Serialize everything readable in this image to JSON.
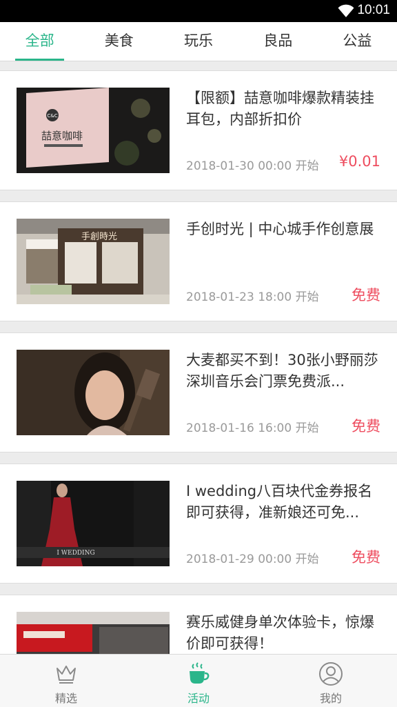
{
  "status_bar": {
    "time": "10:01"
  },
  "tabs": [
    {
      "label": "全部",
      "active": true
    },
    {
      "label": "美食",
      "active": false
    },
    {
      "label": "玩乐",
      "active": false
    },
    {
      "label": "良品",
      "active": false
    },
    {
      "label": "公益",
      "active": false
    }
  ],
  "events": [
    {
      "title": "【限额】喆意咖啡爆款精装挂耳包，内部折扣价",
      "date": "2018-01-30 00:00 开始",
      "price": "¥0.01",
      "thumb_sign_text": "喆意咖啡",
      "thumb_logo_text": "C&C"
    },
    {
      "title": "手创时光 | 中心城手作创意展",
      "date": "2018-01-23 18:00 开始",
      "price": "免费",
      "thumb_sign_text": "手創時光"
    },
    {
      "title": "大麦都买不到！30张小野丽莎深圳音乐会门票免费派...",
      "date": "2018-01-16 16:00 开始",
      "price": "免费"
    },
    {
      "title": "I wedding八百块代金券报名即可获得，准新娘还可免...",
      "date": "2018-01-29 00:00 开始",
      "price": "免费",
      "thumb_sign_text": "I WEDDING"
    },
    {
      "title": "赛乐威健身单次体验卡，惊爆价即可获得！",
      "date": "",
      "price": ""
    }
  ],
  "bottom_nav": [
    {
      "label": "精选",
      "icon": "crown-icon",
      "active": false
    },
    {
      "label": "活动",
      "icon": "coffee-cup-icon",
      "active": true
    },
    {
      "label": "我的",
      "icon": "user-icon",
      "active": false
    }
  ],
  "colors": {
    "accent": "#2ab58a",
    "price": "#ee4d5f"
  }
}
